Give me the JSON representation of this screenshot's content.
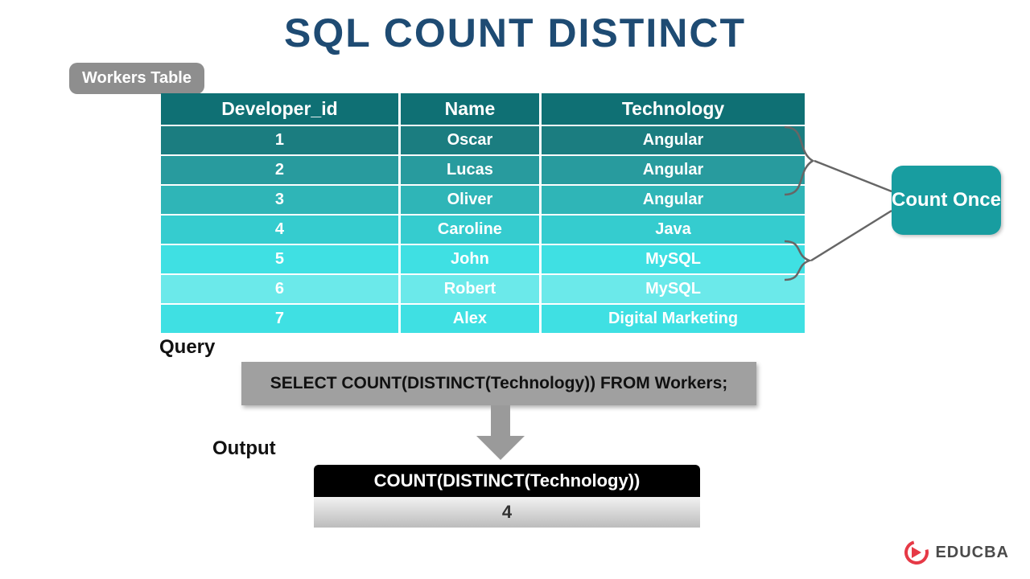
{
  "title": "SQL COUNT DISTINCT",
  "table_label": "Workers Table",
  "columns": [
    "Developer_id",
    "Name",
    "Technology"
  ],
  "rows": [
    {
      "id": "1",
      "name": "Oscar",
      "tech": "Angular"
    },
    {
      "id": "2",
      "name": "Lucas",
      "tech": "Angular"
    },
    {
      "id": "3",
      "name": "Oliver",
      "tech": "Angular"
    },
    {
      "id": "4",
      "name": "Caroline",
      "tech": "Java"
    },
    {
      "id": "5",
      "name": "John",
      "tech": "MySQL"
    },
    {
      "id": "6",
      "name": "Robert",
      "tech": "MySQL"
    },
    {
      "id": "7",
      "name": "Alex",
      "tech": "Digital Marketing"
    }
  ],
  "count_once": "Count Once",
  "query_label": "Query",
  "query_text": "SELECT COUNT(DISTINCT(Technology)) FROM Workers;",
  "output_label": "Output",
  "output_header": "COUNT(DISTINCT(Technology))",
  "output_value": "4",
  "brand": "EDUCBA"
}
